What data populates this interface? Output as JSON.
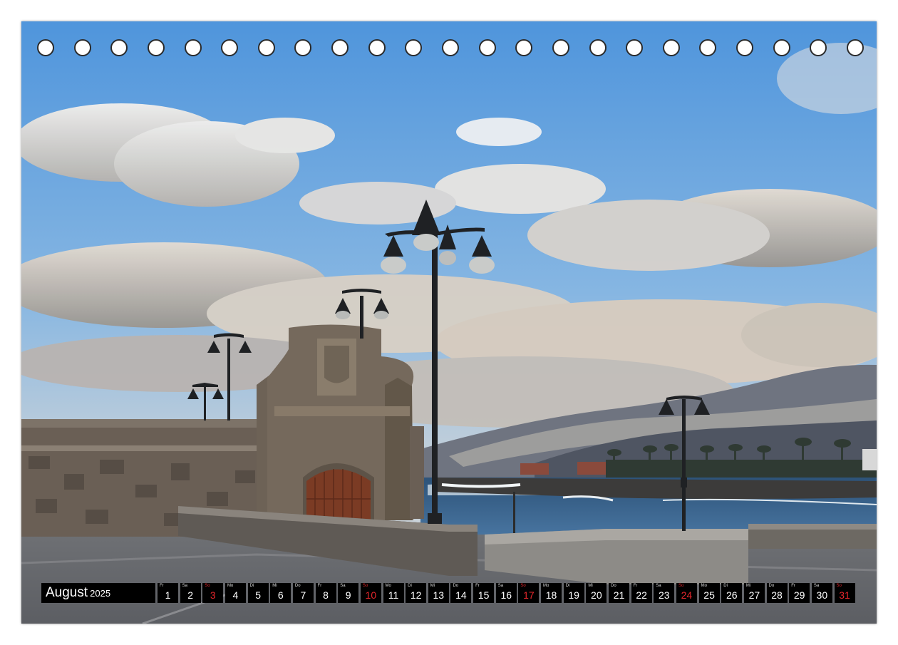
{
  "calendar": {
    "month": "August",
    "year": "2025",
    "sunday_color": "#e3262b",
    "days": [
      {
        "wd": "Fr",
        "n": "1"
      },
      {
        "wd": "Sa",
        "n": "2"
      },
      {
        "wd": "So",
        "n": "3",
        "sun": true
      },
      {
        "wd": "Mo",
        "n": "4"
      },
      {
        "wd": "Di",
        "n": "5"
      },
      {
        "wd": "Mi",
        "n": "6"
      },
      {
        "wd": "Do",
        "n": "7"
      },
      {
        "wd": "Fr",
        "n": "8"
      },
      {
        "wd": "Sa",
        "n": "9"
      },
      {
        "wd": "So",
        "n": "10",
        "sun": true
      },
      {
        "wd": "Mo",
        "n": "11"
      },
      {
        "wd": "Di",
        "n": "12"
      },
      {
        "wd": "Mi",
        "n": "13"
      },
      {
        "wd": "Do",
        "n": "14"
      },
      {
        "wd": "Fr",
        "n": "15"
      },
      {
        "wd": "Sa",
        "n": "16"
      },
      {
        "wd": "So",
        "n": "17",
        "sun": true
      },
      {
        "wd": "Mo",
        "n": "18"
      },
      {
        "wd": "Di",
        "n": "19"
      },
      {
        "wd": "Mi",
        "n": "20"
      },
      {
        "wd": "Do",
        "n": "21"
      },
      {
        "wd": "Fr",
        "n": "22"
      },
      {
        "wd": "Sa",
        "n": "23"
      },
      {
        "wd": "So",
        "n": "24",
        "sun": true
      },
      {
        "wd": "Mo",
        "n": "25"
      },
      {
        "wd": "Di",
        "n": "26"
      },
      {
        "wd": "Mi",
        "n": "27"
      },
      {
        "wd": "Do",
        "n": "28"
      },
      {
        "wd": "Fr",
        "n": "29"
      },
      {
        "wd": "Sa",
        "n": "30"
      },
      {
        "wd": "So",
        "n": "31",
        "sun": true
      }
    ]
  },
  "binding": {
    "hole_count": 23
  },
  "photo": {
    "subject": "coastal-promenade-street-lamps",
    "sky_color": "#5f9fdc",
    "sea_color": "#3a5f88",
    "stone_color": "#6b5f52"
  }
}
